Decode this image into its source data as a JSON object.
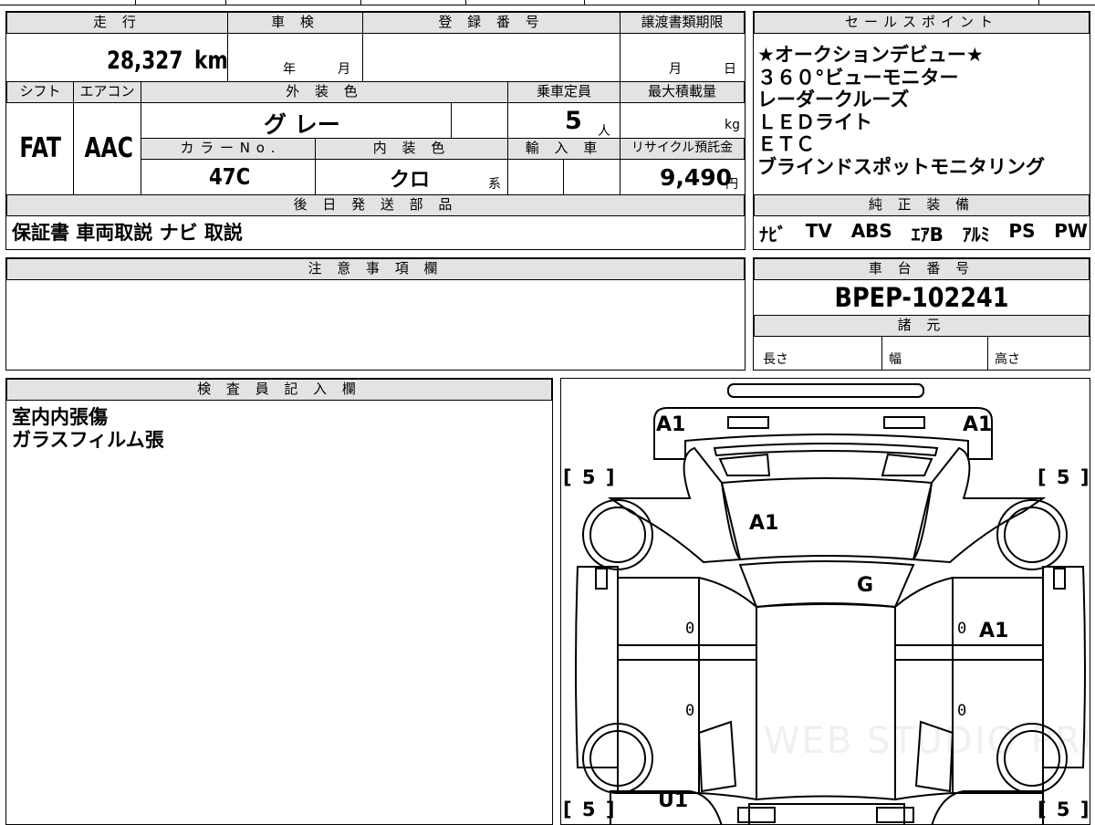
{
  "main_table": {
    "mileage_header": "走 行",
    "mileage_value": "28,327",
    "mileage_unit": "km",
    "inspection_header": "車 検",
    "inspection_year": "年",
    "inspection_month": "月",
    "registration_header": "登 録 番 号",
    "transfer_header": "譲渡書類期限",
    "transfer_month": "月",
    "transfer_day": "日",
    "shift_header": "シフト",
    "aircon_header": "エアコン",
    "exterior_header": "外 装 色",
    "capacity_header": "乗車定員",
    "maxload_header": "最大積載量",
    "shift_value": "FAT",
    "aircon_value": "AAC",
    "exterior_value": "グ レー",
    "capacity_value": "5",
    "capacity_unit": "人",
    "maxload_unit": "kg",
    "color_no_header": "カ ラ ー N o .",
    "interior_header": "内 装 色",
    "import_header": "輸 入 車",
    "recycle_header": "リサイクル預託金",
    "color_no_value": "47C",
    "interior_value": "クロ",
    "interior_suffix": "系",
    "recycle_value": "9,490",
    "recycle_unit": "円",
    "later_parts_header": "後 日 発 送 部 品",
    "later_parts_value": "保証書 車両取説 ナビ 取説"
  },
  "sales_points": {
    "header": "セールスポイント",
    "items": [
      "★オークションデビュー★",
      "３６０°ビューモニター",
      "レーダークルーズ",
      "ＬＥＤライト",
      "ＥＴＣ",
      "ブラインドスポットモニタリング"
    ]
  },
  "equipment": {
    "header": "純 正 装 備",
    "items": [
      "ﾅﾋﾞ",
      "TV",
      "ABS",
      "ｴｱB",
      "ｱﾙﾐ",
      "PS",
      "PW"
    ]
  },
  "notes": {
    "header": "注 意 事 項 欄"
  },
  "chassis": {
    "header": "車 台 番 号",
    "value": "BPEP-102241",
    "specs_header": "諸 元",
    "length_label": "長さ",
    "width_label": "幅",
    "height_label": "高さ"
  },
  "inspector": {
    "header": "検 査 員 記 入 欄",
    "lines": [
      "室内内張傷",
      "ガラスフィルム張"
    ]
  },
  "diagram": {
    "front_left": "A1",
    "front_right": "A1",
    "hood": "A1",
    "windshield": "G",
    "right_front_door": "A1",
    "rear_left": "U1",
    "tyre_fl": "[ 5 ]",
    "tyre_fr": "[ 5 ]",
    "tyre_rl": "[ 5 ]",
    "tyre_rr": "[ 5 ]",
    "door_zero_1": "0",
    "door_zero_2": "0",
    "door_zero_3": "0",
    "door_zero_4": "0",
    "watermark": "WEB STUDIO PRO"
  }
}
